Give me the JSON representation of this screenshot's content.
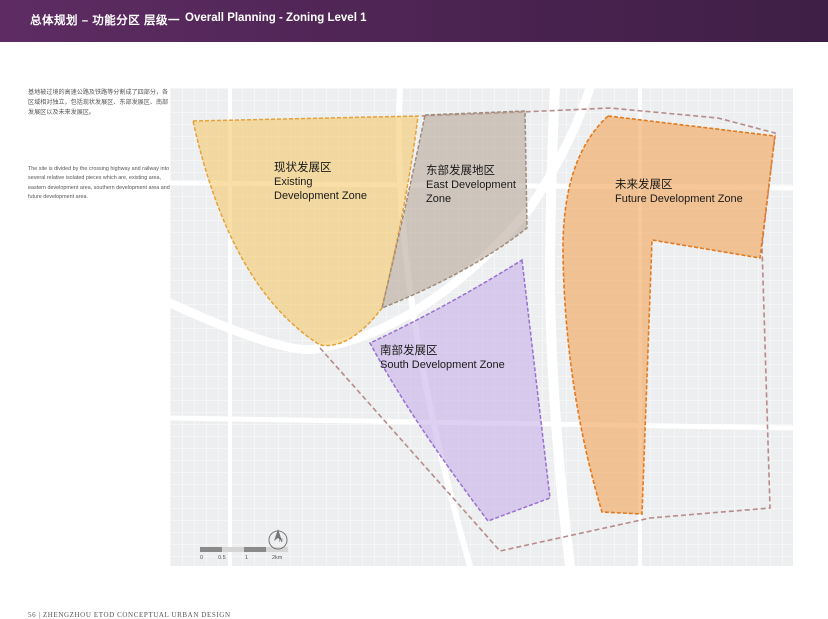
{
  "header": {
    "title_cn": "总体规划 – 功能分区 层级一",
    "title_en": "Overall Planning - Zoning Level 1"
  },
  "description": {
    "cn": "基地被过境的高速公路及铁路等分割成了四部分，各区域相对独立，包括现状发展区、东部发展区、南部发展区以及未来发展区。",
    "en": "The site is divided by the crossing highway and railway into several relative isolated pieces which are, existing area, eastern development area, southern development area and future development area."
  },
  "zones": [
    {
      "id": "existing",
      "label_cn": "现状发展区",
      "label_en_1": "Existing",
      "label_en_2": "Development Zone",
      "color": "#f5c96a"
    },
    {
      "id": "east",
      "label_cn": "东部发展地区",
      "label_en_1": "East Development",
      "label_en_2": "Zone",
      "color": "#b9a99a"
    },
    {
      "id": "south",
      "label_cn": "南部发展区",
      "label_en_1": "South Development Zone",
      "label_en_2": "",
      "color": "#c8b0e8"
    },
    {
      "id": "future",
      "label_cn": "未来发展区",
      "label_en_1": "Future Development Zone",
      "label_en_2": "",
      "color": "#f2a45a"
    }
  ],
  "scale_bar": {
    "labels": [
      "0",
      "0.5",
      "1",
      "2km"
    ]
  },
  "north_arrow": {
    "label": "N"
  },
  "footer": {
    "page_number": "56",
    "title": "ZHENGZHOU ETOD CONCEPTUAL URBAN DESIGN"
  }
}
